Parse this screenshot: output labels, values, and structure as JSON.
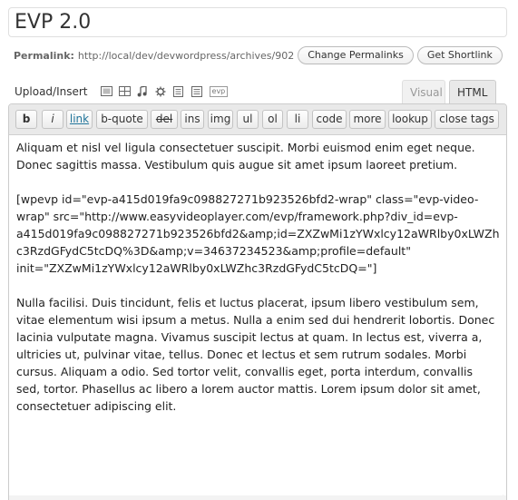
{
  "post_title": "EVP 2.0",
  "permalink": {
    "label": "Permalink:",
    "url": "http://local/dev/devwordpress/archives/902",
    "change_button": "Change Permalinks",
    "shortlink_button": "Get Shortlink"
  },
  "upload": {
    "label": "Upload/Insert",
    "evp_label": "evp"
  },
  "tabs": {
    "visual": "Visual",
    "html": "HTML"
  },
  "quicktags": {
    "b": "b",
    "i": "i",
    "link": "link",
    "bquote": "b-quote",
    "del": "del",
    "ins": "ins",
    "img": "img",
    "ul": "ul",
    "ol": "ol",
    "li": "li",
    "code": "code",
    "more": "more",
    "lookup": "lookup",
    "close_tags": "close tags"
  },
  "editor_content": "Aliquam et nisl vel ligula consectetuer suscipit. Morbi euismod enim eget neque.\nDonec sagittis massa. Vestibulum quis augue sit amet ipsum laoreet pretium.\n\n[wpevp id=\"evp-a415d019fa9c098827271b923526bfd2-wrap\" class=\"evp-video-\nwrap\" src=\"http://www.easyvideoplayer.com/evp/framework.php?div_id=evp-\na415d019fa9c098827271b923526bfd2&amp;id=ZXZwMi1zYWxlcy12aWRlby0xLWZh\nc3RzdGFydC5tcDQ%3D&amp;v=34637234523&amp;profile=default\"\ninit=\"ZXZwMi1zYWxlcy12aWRlby0xLWZhc3RzdGFydC5tcDQ=\"]\n\nNulla facilisi. Duis tincidunt, felis et luctus placerat, ipsum libero vestibulum sem,\nvitae elementum wisi ipsum a metus. Nulla a enim sed dui hendrerit lobortis. Donec\nlacinia vulputate magna. Vivamus suscipit lectus at quam. In lectus est, viverra a,\nultricies ut, pulvinar vitae, tellus. Donec et lectus et sem rutrum sodales. Morbi\ncursus. Aliquam a odio. Sed tortor velit, convallis eget, porta interdum, convallis\nsed, tortor. Phasellus ac libero a lorem auctor mattis. Lorem ipsum dolor sit amet,\nconsectetuer adipiscing elit."
}
